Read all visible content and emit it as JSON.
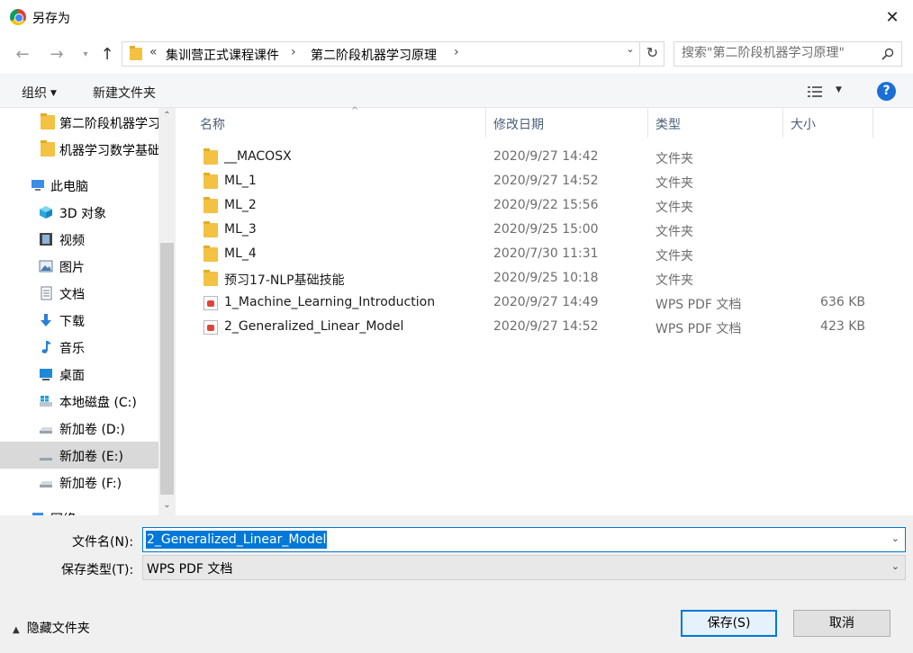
{
  "window": {
    "title": "另存为"
  },
  "address": {
    "overflow": "«",
    "crumbs": [
      "集训营正式课程课件",
      "第二阶段机器学习原理"
    ],
    "search_placeholder": "搜索\"第二阶段机器学习原理\""
  },
  "toolbar": {
    "organize": "组织",
    "new_folder": "新建文件夹"
  },
  "nav": {
    "items": [
      {
        "label": "第二阶段机器学习",
        "icon": "folder-icon"
      },
      {
        "label": "机器学习数学基础",
        "icon": "folder-icon"
      },
      {
        "label": "此电脑",
        "icon": "computer-icon"
      },
      {
        "label": "3D 对象",
        "icon": "cube-icon"
      },
      {
        "label": "视频",
        "icon": "film-icon"
      },
      {
        "label": "图片",
        "icon": "picture-icon"
      },
      {
        "label": "文档",
        "icon": "document-icon"
      },
      {
        "label": "下载",
        "icon": "download-icon"
      },
      {
        "label": "音乐",
        "icon": "music-icon"
      },
      {
        "label": "桌面",
        "icon": "desktop-icon"
      },
      {
        "label": "本地磁盘 (C:)",
        "icon": "windows-drive-icon"
      },
      {
        "label": "新加卷 (D:)",
        "icon": "drive-icon"
      },
      {
        "label": "新加卷 (E:)",
        "icon": "drive-icon"
      },
      {
        "label": "新加卷 (F:)",
        "icon": "drive-icon"
      },
      {
        "label": "网络",
        "icon": "network-icon"
      }
    ]
  },
  "columns": {
    "name": "名称",
    "date": "修改日期",
    "type": "类型",
    "size": "大小"
  },
  "files": [
    {
      "name": "__MACOSX",
      "date": "2020/9/27 14:42",
      "type": "文件夹",
      "size": "",
      "icon": "folder-icon"
    },
    {
      "name": "ML_1",
      "date": "2020/9/27 14:52",
      "type": "文件夹",
      "size": "",
      "icon": "folder-icon"
    },
    {
      "name": "ML_2",
      "date": "2020/9/22 15:56",
      "type": "文件夹",
      "size": "",
      "icon": "folder-icon"
    },
    {
      "name": "ML_3",
      "date": "2020/9/25 15:00",
      "type": "文件夹",
      "size": "",
      "icon": "folder-icon"
    },
    {
      "name": "ML_4",
      "date": "2020/7/30 11:31",
      "type": "文件夹",
      "size": "",
      "icon": "folder-icon"
    },
    {
      "name": "预习17-NLP基础技能",
      "date": "2020/9/25 10:18",
      "type": "文件夹",
      "size": "",
      "icon": "folder-icon"
    },
    {
      "name": "1_Machine_Learning_Introduction",
      "date": "2020/9/27 14:49",
      "type": "WPS PDF 文档",
      "size": "636 KB",
      "icon": "pdf-icon"
    },
    {
      "name": "2_Generalized_Linear_Model",
      "date": "2020/9/27 14:52",
      "type": "WPS PDF 文档",
      "size": "423 KB",
      "icon": "pdf-icon"
    }
  ],
  "form": {
    "filename_label": "文件名(N):",
    "filename_value": "2_Generalized_Linear_Model",
    "type_label": "保存类型(T):",
    "type_value": "WPS PDF 文档",
    "hide_folders": "隐藏文件夹",
    "save": "保存(S)",
    "cancel": "取消"
  },
  "colors": {
    "accent": "#0078d7",
    "help": "#1a6fd6",
    "folder": "#f3c243",
    "pdf": "#e0433b"
  }
}
